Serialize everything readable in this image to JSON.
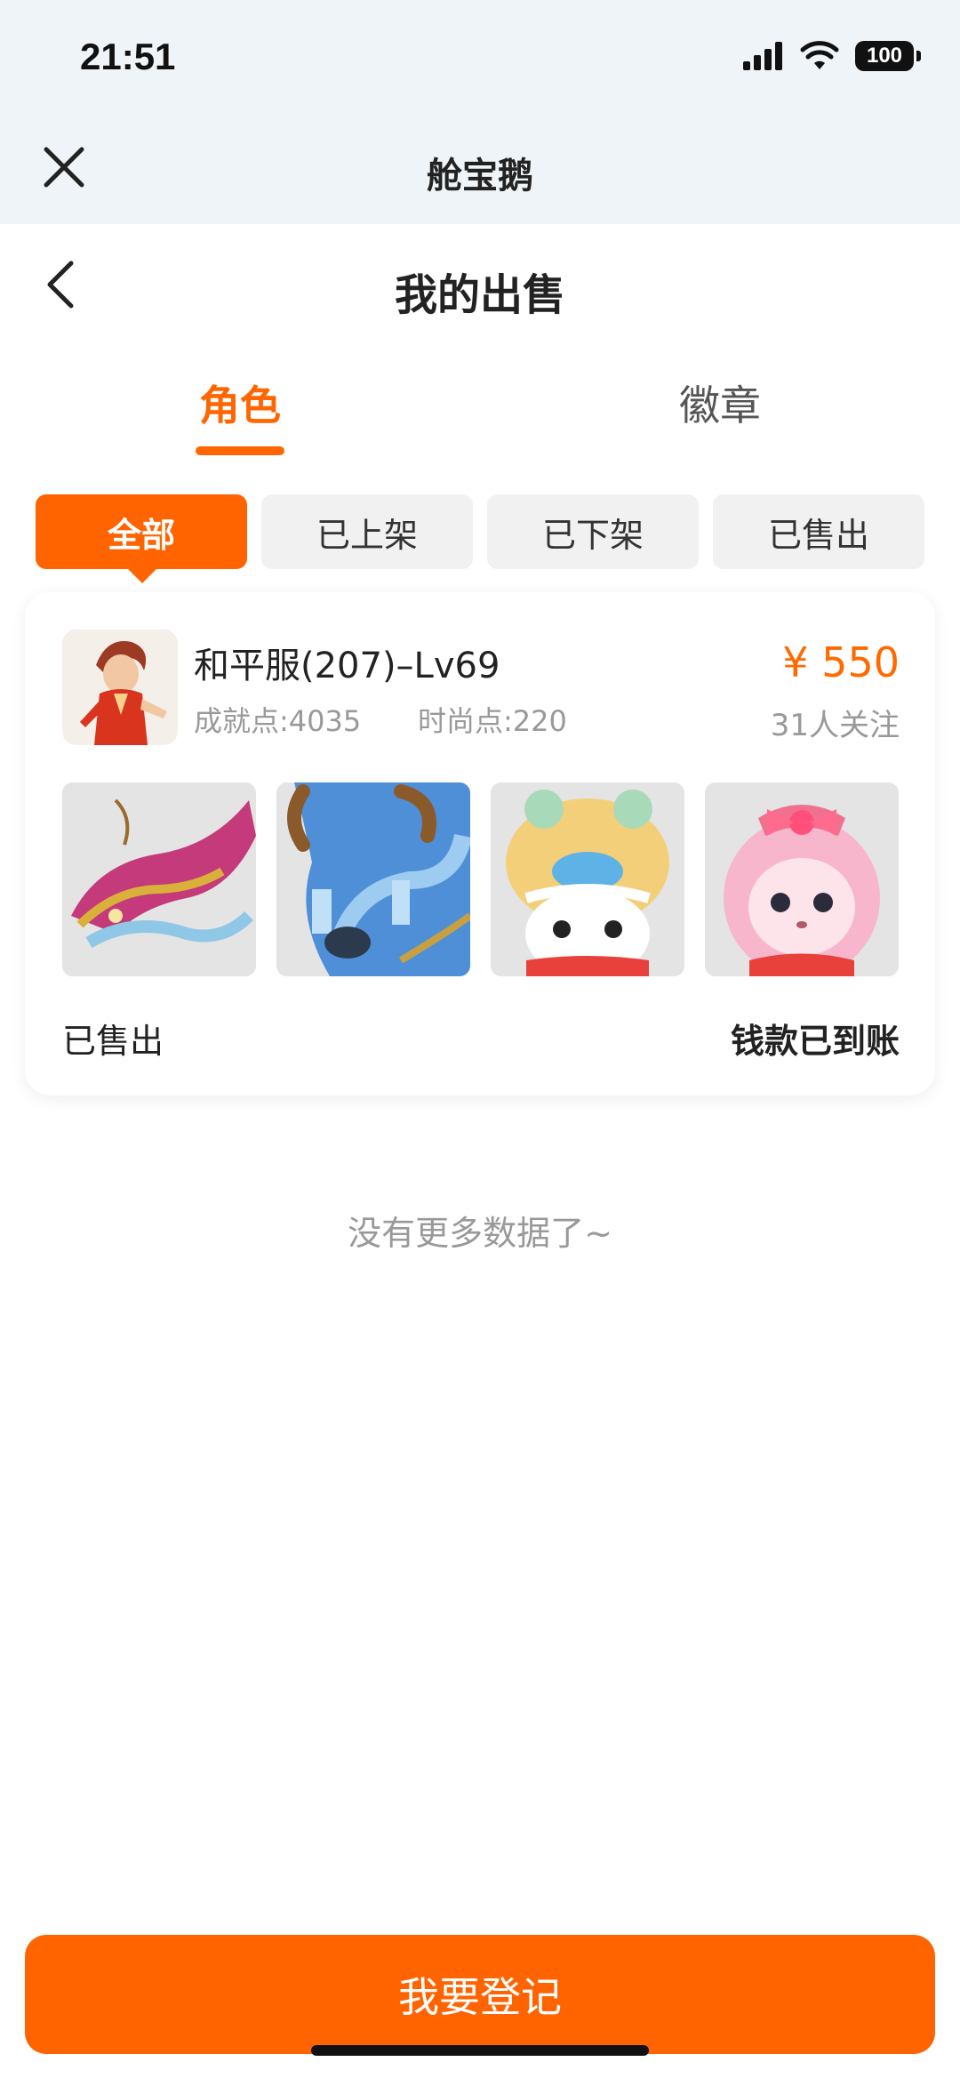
{
  "status_bar": {
    "time": "21:51",
    "battery": "100"
  },
  "header": {
    "app_title": "舱宝鹅",
    "page_title": "我的出售"
  },
  "tabs": [
    {
      "label": "角色"
    },
    {
      "label": "徽章"
    }
  ],
  "filters": [
    {
      "label": "全部"
    },
    {
      "label": "已上架"
    },
    {
      "label": "已下架"
    },
    {
      "label": "已售出"
    }
  ],
  "listing": {
    "title": "和平服(207)–Lv69",
    "achievement": "成就点:4035",
    "fashion": "时尚点:220",
    "price": "¥ 550",
    "followers": "31人关注",
    "thumbnails": [
      "dragon",
      "blue-beast",
      "lion-dance-bear",
      "pink-bunny"
    ],
    "status": "已售出",
    "payment_status": "钱款已到账"
  },
  "list_end_text": "没有更多数据了~",
  "register_button": "我要登记",
  "colors": {
    "accent": "#ff6400",
    "price": "#ff6a00"
  }
}
